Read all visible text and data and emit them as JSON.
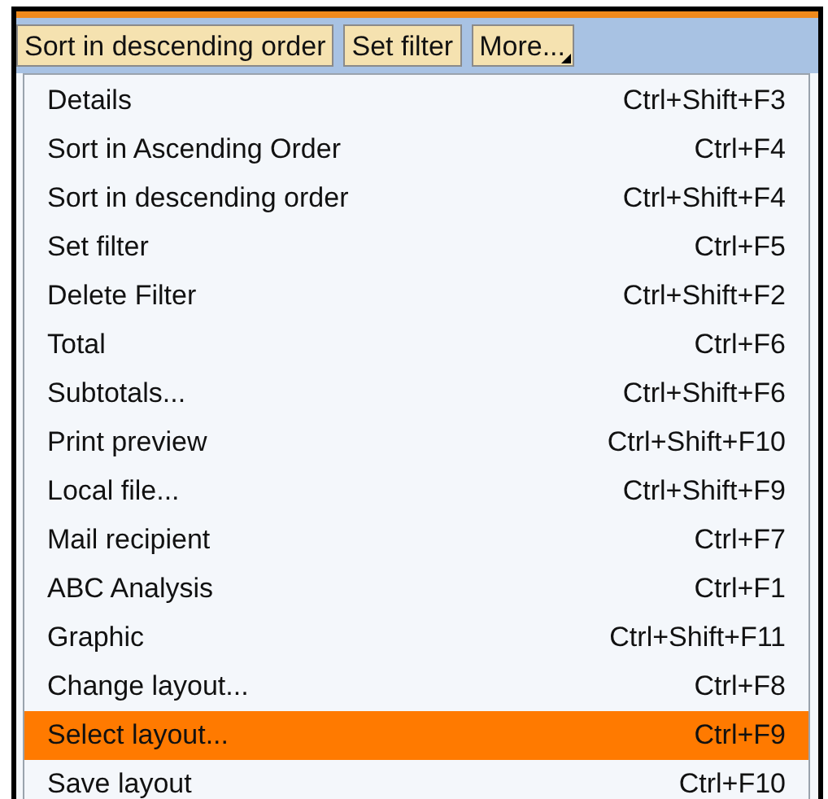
{
  "toolbar": {
    "buttons": [
      {
        "label": "Sort in descending order",
        "kind": "plain"
      },
      {
        "label": "Set filter",
        "kind": "plain"
      },
      {
        "label": "More...",
        "kind": "dropdown"
      }
    ]
  },
  "menu": {
    "items": [
      {
        "label": "Details",
        "shortcut": "Ctrl+Shift+F3",
        "selected": false
      },
      {
        "label": "Sort in Ascending Order",
        "shortcut": "Ctrl+F4",
        "selected": false
      },
      {
        "label": "Sort in descending order",
        "shortcut": "Ctrl+Shift+F4",
        "selected": false
      },
      {
        "label": "Set filter",
        "shortcut": "Ctrl+F5",
        "selected": false
      },
      {
        "label": "Delete Filter",
        "shortcut": "Ctrl+Shift+F2",
        "selected": false
      },
      {
        "label": "Total",
        "shortcut": "Ctrl+F6",
        "selected": false
      },
      {
        "label": "Subtotals...",
        "shortcut": "Ctrl+Shift+F6",
        "selected": false
      },
      {
        "label": "Print preview",
        "shortcut": "Ctrl+Shift+F10",
        "selected": false
      },
      {
        "label": "Local file...",
        "shortcut": "Ctrl+Shift+F9",
        "selected": false
      },
      {
        "label": "Mail recipient",
        "shortcut": "Ctrl+F7",
        "selected": false
      },
      {
        "label": "ABC Analysis",
        "shortcut": "Ctrl+F1",
        "selected": false
      },
      {
        "label": "Graphic",
        "shortcut": "Ctrl+Shift+F11",
        "selected": false
      },
      {
        "label": "Change layout...",
        "shortcut": "Ctrl+F8",
        "selected": false
      },
      {
        "label": "Select layout...",
        "shortcut": "Ctrl+F9",
        "selected": true
      },
      {
        "label": "Save layout",
        "shortcut": "Ctrl+F10",
        "selected": false
      }
    ]
  }
}
